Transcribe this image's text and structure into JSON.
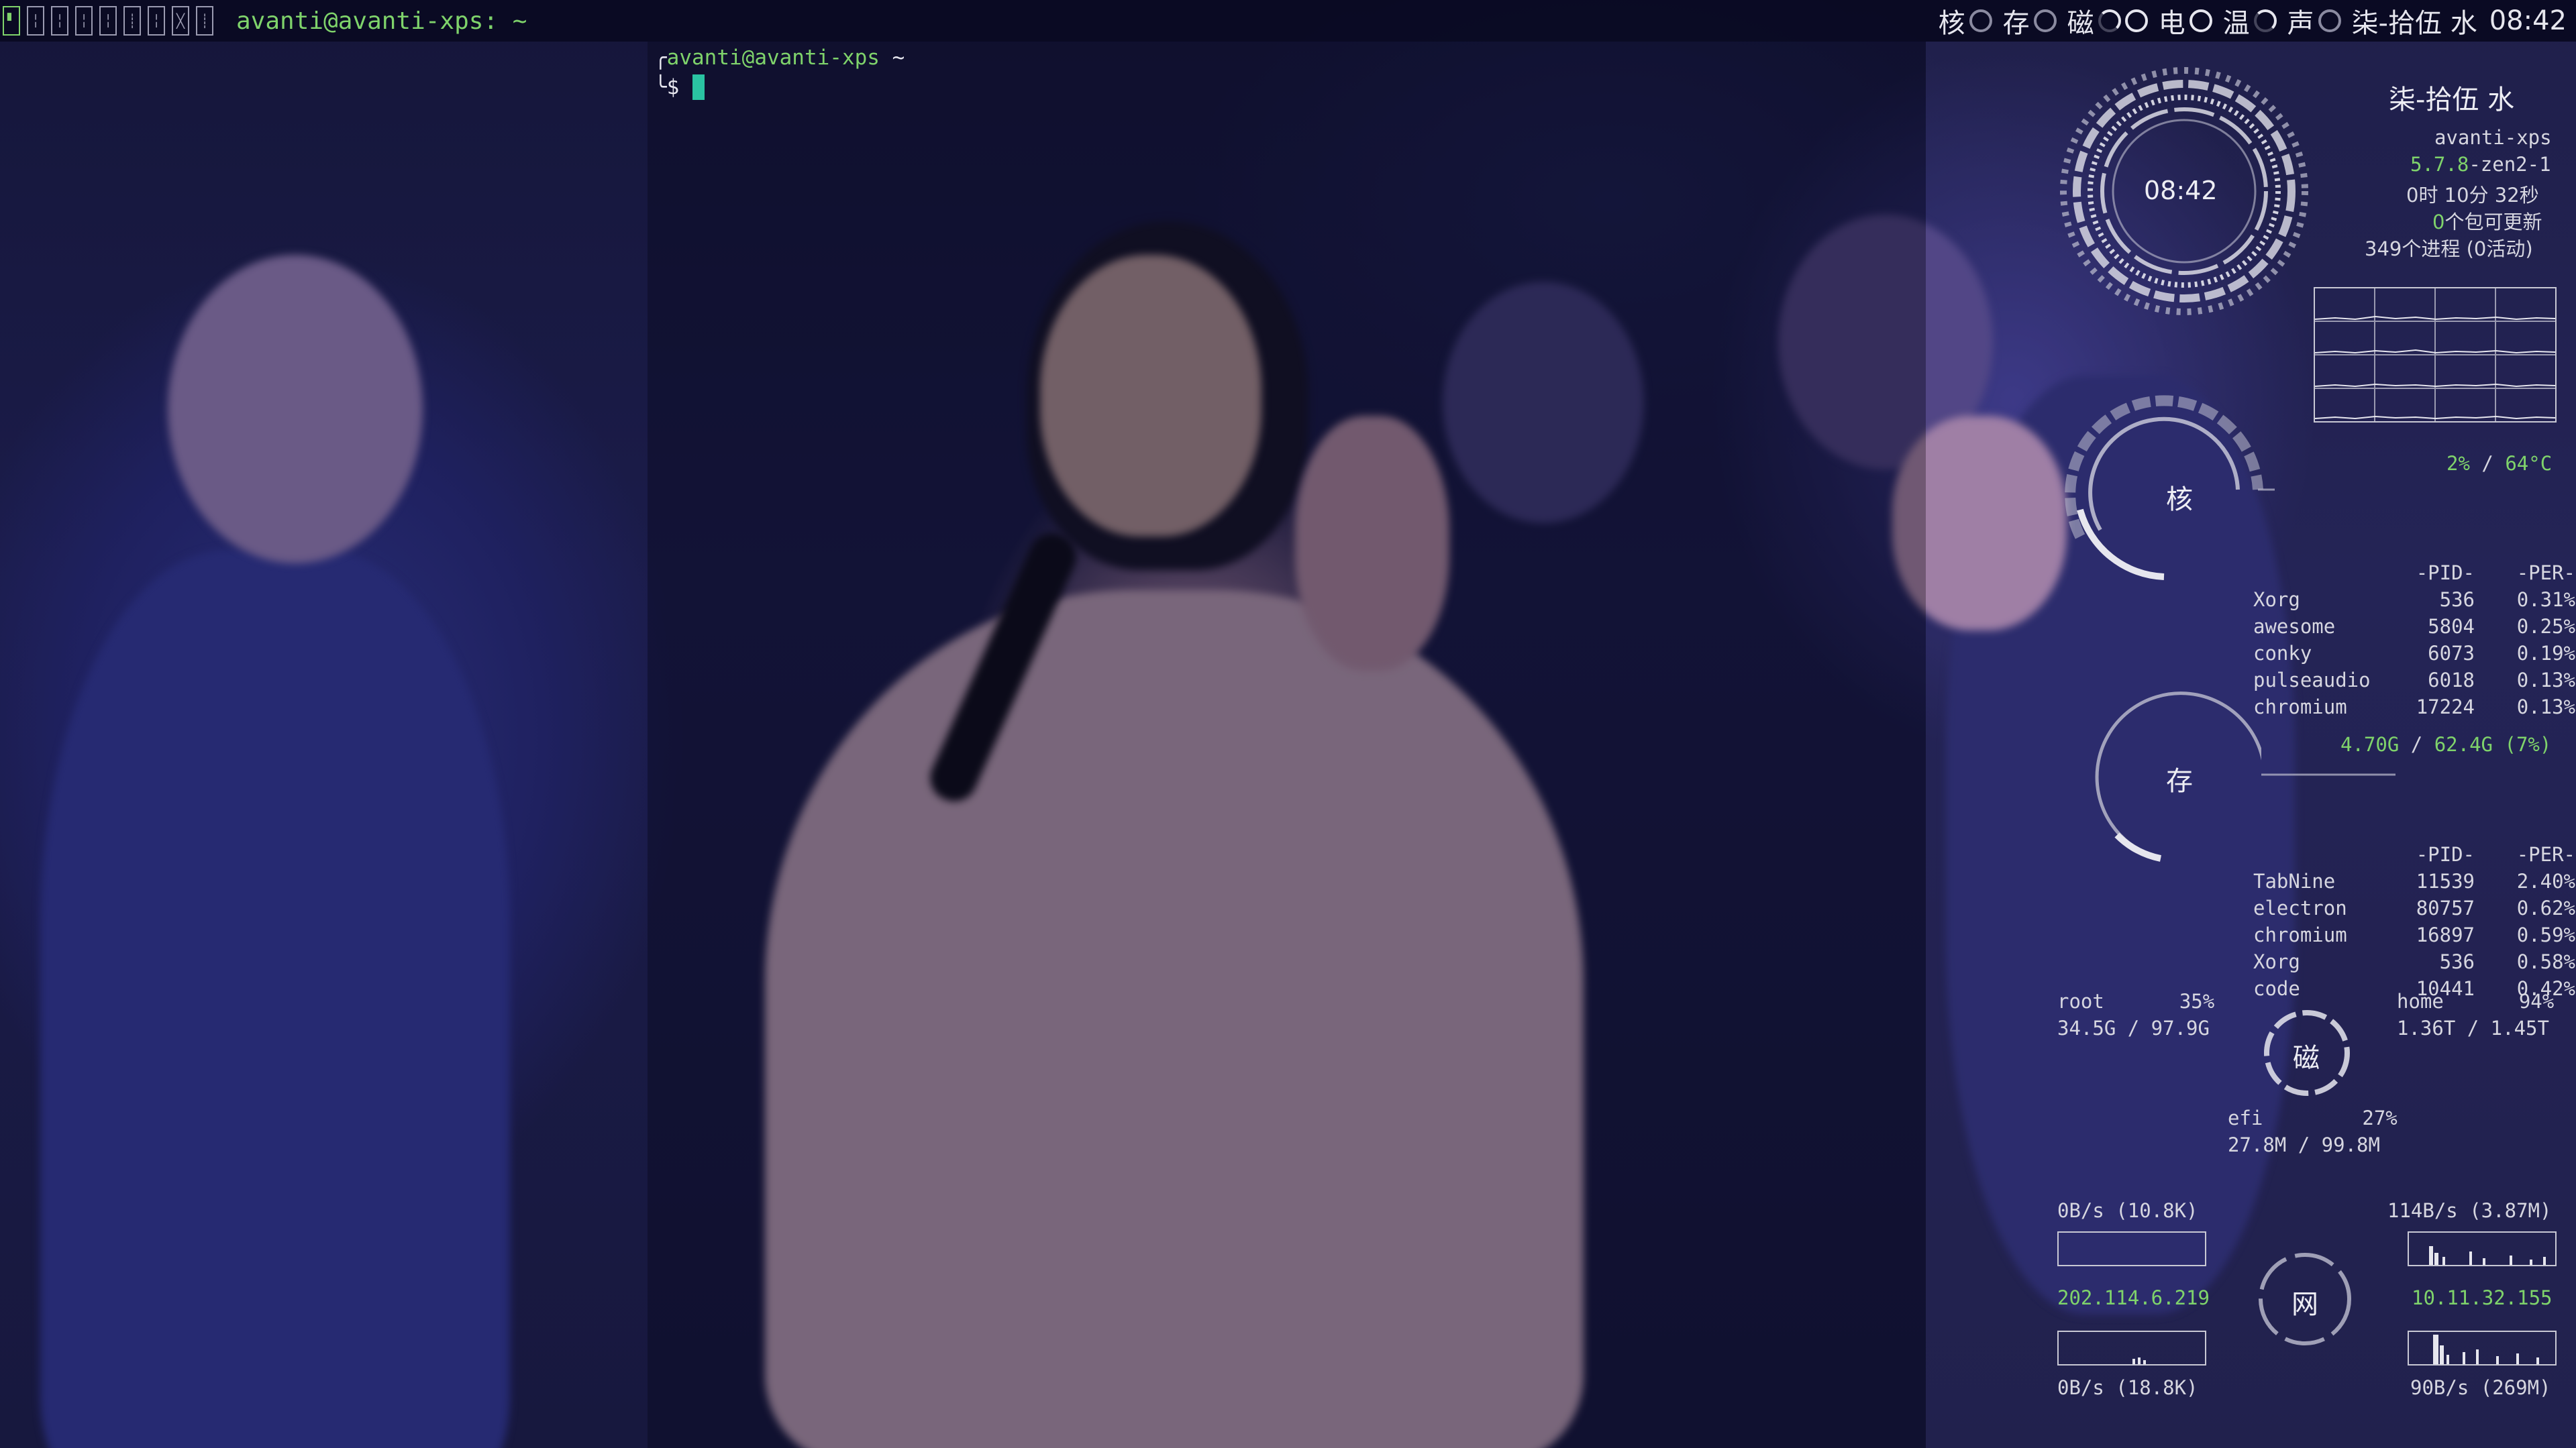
{
  "topbar": {
    "tags": [
      "1",
      "2",
      "3",
      "4",
      "5",
      "6",
      "7",
      "8",
      "9"
    ],
    "window_title": "avanti@avanti-xps: ~",
    "widgets": {
      "cpu": "核",
      "mem": "存",
      "disk": "磁",
      "power": "电",
      "temp": "温",
      "sound": "声",
      "date": "柒-拾伍 水",
      "time": "08:42"
    }
  },
  "terminal": {
    "prompt_user": "avanti@avanti-xps",
    "prompt_dir": "~",
    "prompt_symbol": "$"
  },
  "conky": {
    "clock": "08:42",
    "date": "柒-拾伍 水",
    "host": "avanti-xps",
    "kernel_version": "5.7.8",
    "kernel_suffix": "-zen2-1",
    "uptime": "0时 10分 32秒",
    "updates_count": "0",
    "updates_text": "个包可更新",
    "processes": "349个进程 (0活动)",
    "cpu": {
      "label": "核",
      "usage": "2%",
      "sep": " / ",
      "temp": "64°C",
      "col_pid": "-PID-",
      "col_per": "-PER-",
      "procs": [
        {
          "name": "Xorg",
          "pid": "536",
          "per": "0.31%"
        },
        {
          "name": "awesome",
          "pid": "5804",
          "per": "0.25%"
        },
        {
          "name": "conky",
          "pid": "6073",
          "per": "0.19%"
        },
        {
          "name": "pulseaudio",
          "pid": "6018",
          "per": "0.13%"
        },
        {
          "name": "chromium",
          "pid": "17224",
          "per": "0.13%"
        }
      ]
    },
    "mem": {
      "label": "存",
      "used": "4.70G",
      "sep": " / ",
      "total": "62.4G",
      "percent": "(7%)",
      "col_pid": "-PID-",
      "col_per": "-PER-",
      "procs": [
        {
          "name": "TabNine",
          "pid": "11539",
          "per": "2.40%"
        },
        {
          "name": "electron",
          "pid": "80757",
          "per": "0.62%"
        },
        {
          "name": "chromium",
          "pid": "16897",
          "per": "0.59%"
        },
        {
          "name": "Xorg",
          "pid": "536",
          "per": "0.58%"
        },
        {
          "name": "code",
          "pid": "10441",
          "per": "0.42%"
        }
      ]
    },
    "disk": {
      "label": "磁",
      "root_name": "root",
      "root_pct": "35%",
      "root_usage": "34.5G / 97.9G",
      "home_name": "home",
      "home_pct": "94%",
      "home_usage": "1.36T / 1.45T",
      "efi_name": "efi",
      "efi_pct": "27%",
      "efi_usage": "27.8M / 99.8M"
    },
    "net": {
      "label": "网",
      "left_up": "0B/s (10.8K)",
      "left_ip": "202.114.6.219",
      "left_down": "0B/s (18.8K)",
      "right_up": "114B/s (3.87M)",
      "right_ip": "10.11.32.155",
      "right_down": "90B/s (269M)"
    }
  }
}
